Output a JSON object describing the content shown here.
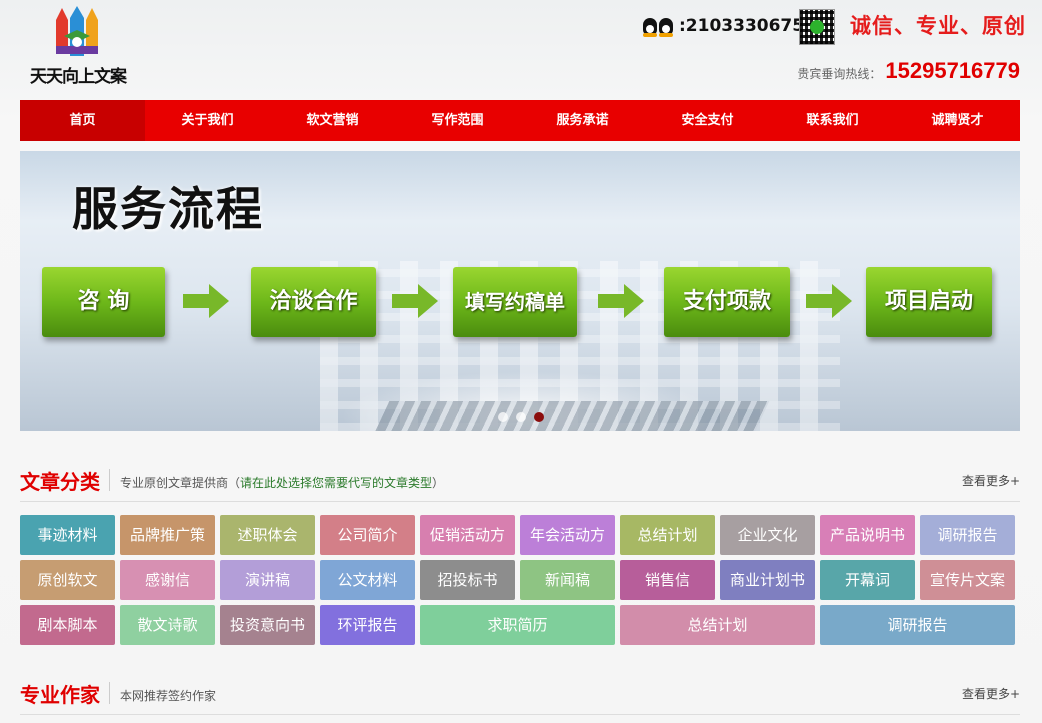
{
  "header": {
    "logo_text": "天天向上文案",
    "qq_number": ":2103330675",
    "slogan": "诚信、专业、原创",
    "hotline_label": "贵宾垂询热线：",
    "hotline_number": "15295716779"
  },
  "nav": {
    "items": [
      "首页",
      "关于我们",
      "软文营销",
      "写作范围",
      "服务承诺",
      "安全支付",
      "联系我们",
      "诚聘贤才"
    ]
  },
  "banner": {
    "title": "服务流程",
    "steps": [
      "咨 询",
      "洽谈合作",
      "填写约稿单",
      "支付项款",
      "项目启动"
    ],
    "slides_total": 3,
    "active_slide": 3
  },
  "articles": {
    "title": "文章分类",
    "desc": "专业原创文章提供商（",
    "hint": "请在此处选择您需要代写的文章类型",
    "desc_end": "）",
    "more": "查看更多+",
    "categories": [
      {
        "label": "事迹材料",
        "color": "#4aa3b0"
      },
      {
        "label": "品牌推广策",
        "color": "#c6956a"
      },
      {
        "label": "述职体会",
        "color": "#aab56d"
      },
      {
        "label": "公司简介",
        "color": "#d37f88"
      },
      {
        "label": "促销活动方",
        "color": "#d77faf"
      },
      {
        "label": "年会活动方",
        "color": "#bc7fd8"
      },
      {
        "label": "总结计划",
        "color": "#a7b864"
      },
      {
        "label": "企业文化",
        "color": "#a79fa1"
      },
      {
        "label": "产品说明书",
        "color": "#d87fb7"
      },
      {
        "label": "调研报告",
        "color": "#a4aed8"
      },
      {
        "label": "原创软文",
        "color": "#c69d72"
      },
      {
        "label": "感谢信",
        "color": "#d790b2"
      },
      {
        "label": "演讲稿",
        "color": "#b39ed8"
      },
      {
        "label": "公文材料",
        "color": "#7fa6d6"
      },
      {
        "label": "招投标书",
        "color": "#8d8d8d"
      },
      {
        "label": "新闻稿",
        "color": "#8ec483"
      },
      {
        "label": "销售信",
        "color": "#b75e9a"
      },
      {
        "label": "商业计划书",
        "color": "#7f7fc0"
      },
      {
        "label": "开幕词",
        "color": "#58a6a9"
      },
      {
        "label": "宣传片文案",
        "color": "#cf8f96"
      },
      {
        "label": "剧本脚本",
        "color": "#c26a8e"
      },
      {
        "label": "散文诗歌",
        "color": "#8fd0a0"
      },
      {
        "label": "投资意向书",
        "color": "#a5828f"
      },
      {
        "label": "环评报告",
        "color": "#8270de"
      },
      {
        "label": "求职简历",
        "color": "#7fcf9b"
      },
      {
        "label": "总结计划",
        "color": "#d28daa"
      },
      {
        "label": "调研报告",
        "color": "#79a9c9"
      }
    ]
  },
  "writers": {
    "title": "专业作家",
    "desc": "本网推荐签约作家",
    "more": "查看更多+"
  }
}
